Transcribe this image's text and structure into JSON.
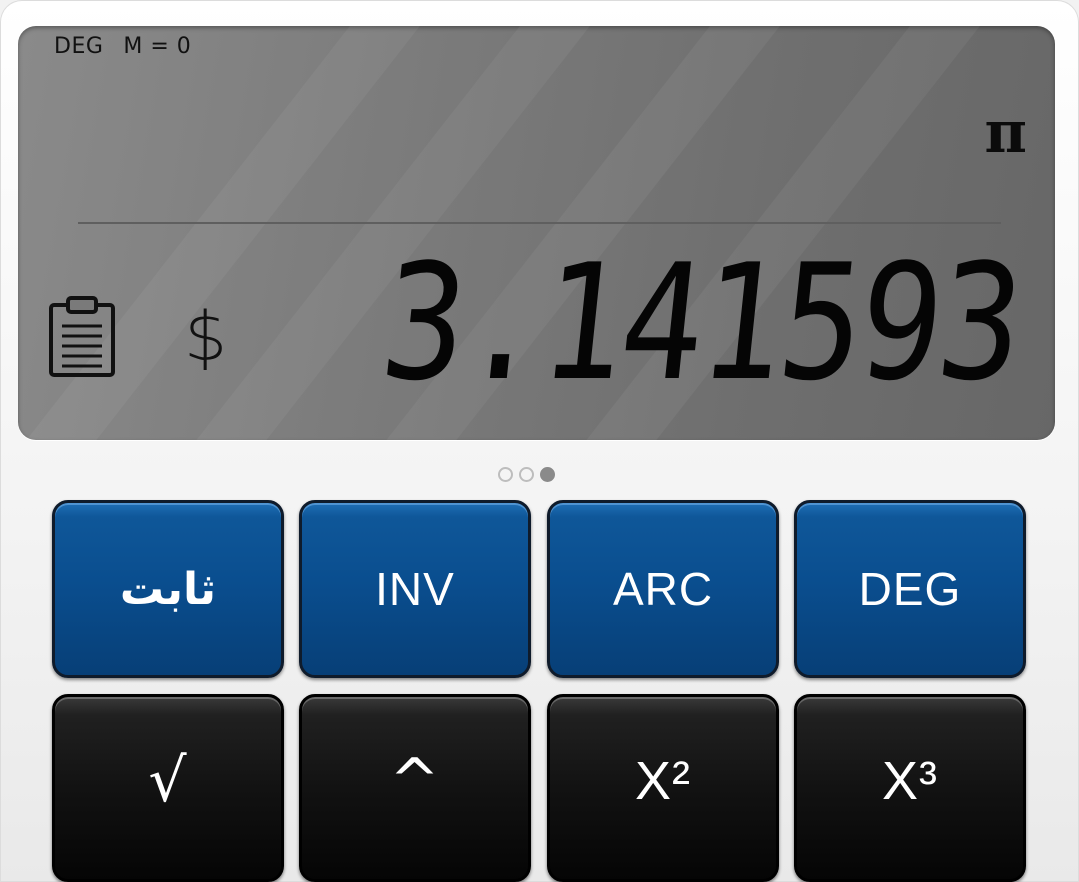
{
  "display": {
    "angle_mode": "DEG",
    "memory": "M = 0",
    "expression": "π",
    "result": "3.141593",
    "currency_symbol": "$",
    "clipboard_icon": "clipboard-icon"
  },
  "pager": {
    "pages": 3,
    "active_index": 2
  },
  "keys_row1": [
    {
      "label": "ثابت"
    },
    {
      "label": "INV"
    },
    {
      "label": "ARC"
    },
    {
      "label": "DEG"
    }
  ],
  "keys_row2": [
    {
      "label": "√"
    },
    {
      "label": "^"
    },
    {
      "label": "X²"
    },
    {
      "label": "X³"
    }
  ],
  "colors": {
    "display_bg": "#7c7c7c",
    "function_key": "#0a4e8f",
    "operator_key": "#121212"
  }
}
